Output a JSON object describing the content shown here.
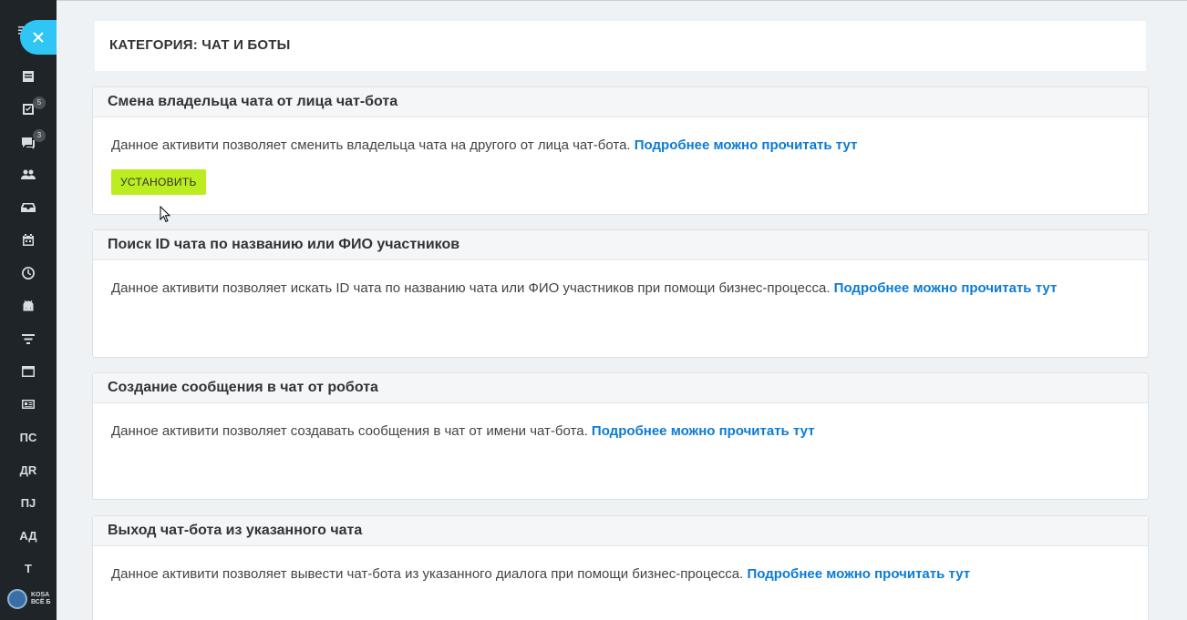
{
  "category": {
    "title": "КАТЕГОРИЯ: ЧАТ И БОТЫ"
  },
  "sidebar": {
    "badges": {
      "tasks": "5",
      "chat": "3"
    },
    "text_items": [
      "ПС",
      "ДR",
      "ПJ",
      "АД",
      "Т"
    ],
    "brand": {
      "line1": "KOSA",
      "line2": "ВСЁ Б"
    }
  },
  "cards": [
    {
      "title": "Смена владельца чата от лица чат-бота",
      "description": "Данное активити позволяет сменить владельца чата на другого от лица чат-бота.",
      "link": "Подробнее можно прочитать тут",
      "button": "УСТАНОВИТЬ"
    },
    {
      "title": "Поиск ID чата по названию или ФИО участников",
      "description": "Данное активити позволяет искать ID чата по названию чата или ФИО участников при помощи бизнес-процесса.",
      "link": "Подробнее можно прочитать тут"
    },
    {
      "title": "Создание сообщения в чат от робота",
      "description": "Данное активити позволяет создавать сообщения в чат от имени чат-бота.",
      "link": "Подробнее можно прочитать тут"
    },
    {
      "title": "Выход чат-бота из указанного чата",
      "description": "Данное активити позволяет вывести чат-бота из указанного диалога при помощи бизнес-процесса.",
      "link": "Подробнее можно прочитать тут"
    }
  ],
  "colors": {
    "sidebar_bg": "#1f2428",
    "accent_close": "#2fc6f6",
    "install_button": "#bbed21",
    "link": "#0b7bd6"
  }
}
